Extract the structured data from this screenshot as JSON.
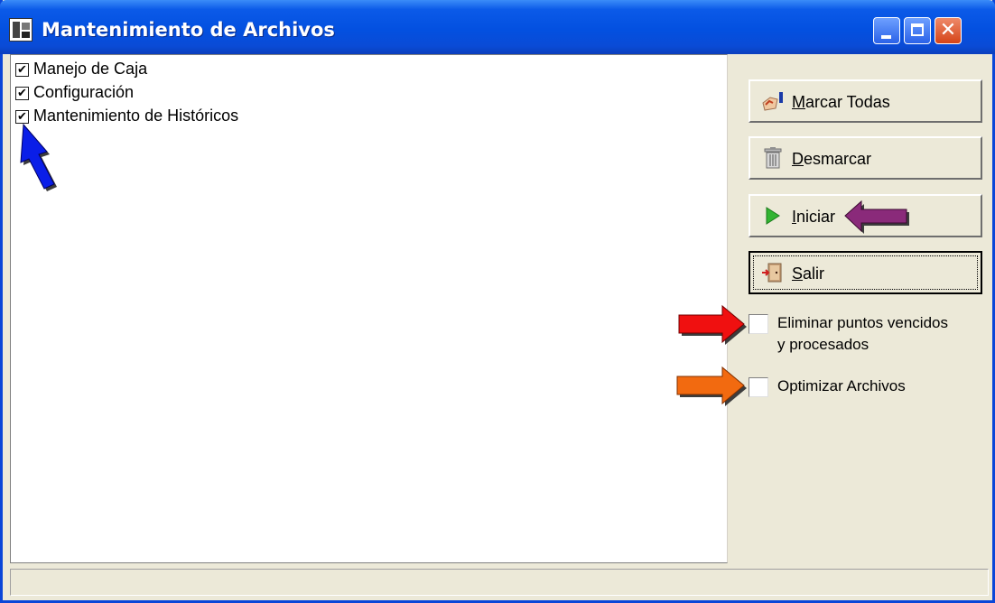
{
  "window": {
    "title": "Mantenimiento de Archivos",
    "titlebar_color": "#0350e0",
    "controls": [
      "minimize-icon",
      "maximize-icon",
      "close-icon"
    ],
    "close_glyph": "✕"
  },
  "list": {
    "items": [
      {
        "label": "Manejo de Caja",
        "checked": true,
        "mark": "✔"
      },
      {
        "label": "Configuración",
        "checked": true,
        "mark": "✔"
      },
      {
        "label": "Mantenimiento de Históricos",
        "checked": true,
        "mark": "✔"
      }
    ]
  },
  "actions": {
    "marcar_todas": {
      "label": "Marcar Todas",
      "icon": "check-all-icon"
    },
    "desmarcar": {
      "label": "Desmarcar",
      "icon": "trash-icon"
    },
    "iniciar": {
      "label": "Iniciar",
      "icon": "play-icon"
    },
    "salir": {
      "label": "Salir",
      "icon": "exit-door-icon"
    }
  },
  "options": {
    "eliminar": {
      "label_line1": "Eliminar puntos vencidos",
      "label_line2": "y procesados",
      "checked": false
    },
    "optimizar": {
      "label": "Optimizar Archivos",
      "checked": false
    }
  },
  "annotations": {
    "colors": {
      "blue": "#0a1ee8",
      "purple": "#8a2a7a",
      "red": "#f01010",
      "orange": "#f26a10"
    }
  }
}
